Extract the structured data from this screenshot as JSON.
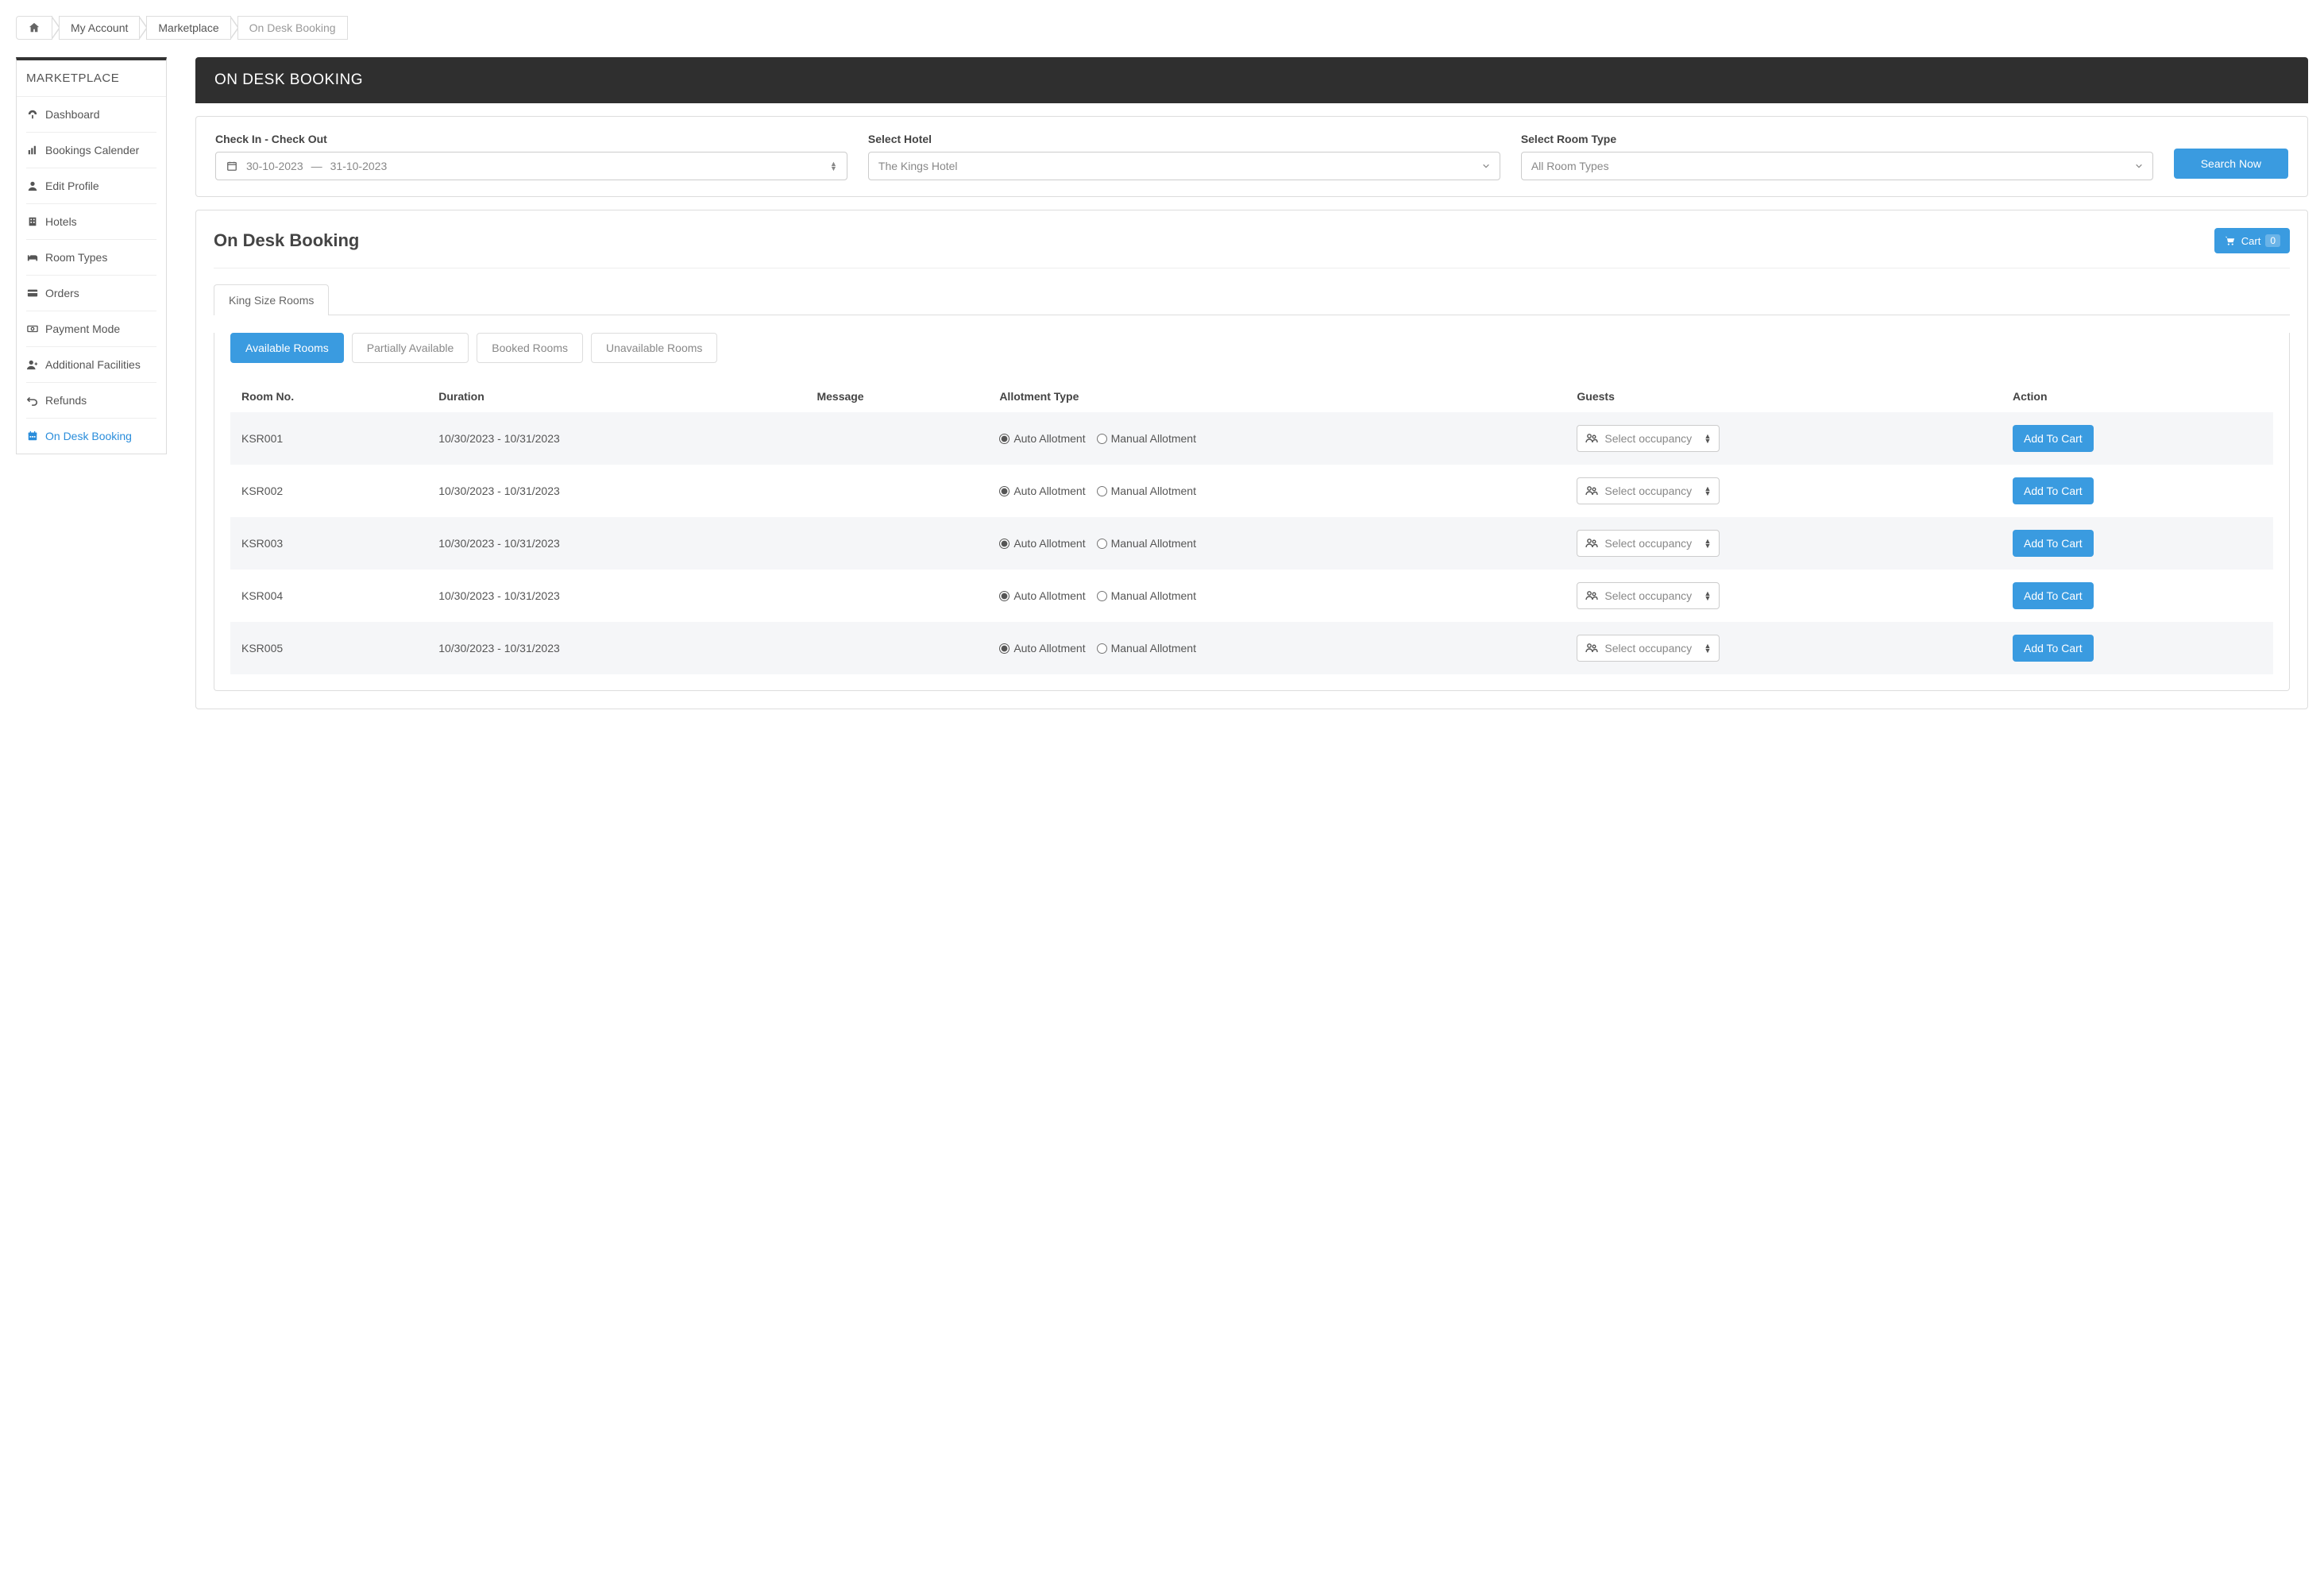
{
  "breadcrumb": {
    "items": [
      {
        "label": "",
        "icon": "home"
      },
      {
        "label": "My Account"
      },
      {
        "label": "Marketplace"
      },
      {
        "label": "On Desk Booking",
        "active": true
      }
    ]
  },
  "sidebar": {
    "title": "MARKETPLACE",
    "items": [
      {
        "label": "Dashboard",
        "icon": "dashboard"
      },
      {
        "label": "Bookings Calender",
        "icon": "bar-chart"
      },
      {
        "label": "Edit Profile",
        "icon": "user"
      },
      {
        "label": "Hotels",
        "icon": "building"
      },
      {
        "label": "Room Types",
        "icon": "bed"
      },
      {
        "label": "Orders",
        "icon": "credit-card"
      },
      {
        "label": "Payment Mode",
        "icon": "cash"
      },
      {
        "label": "Additional Facilities",
        "icon": "user-plus"
      },
      {
        "label": "Refunds",
        "icon": "undo"
      },
      {
        "label": "On Desk Booking",
        "icon": "calendar",
        "selected": true
      }
    ]
  },
  "header": {
    "title": "ON DESK BOOKING"
  },
  "filters": {
    "checkin_label": "Check In - Check Out",
    "date_from": "30-10-2023",
    "date_sep": "—",
    "date_to": "31-10-2023",
    "hotel_label": "Select Hotel",
    "hotel_value": "The Kings Hotel",
    "room_label": "Select Room Type",
    "room_value": "All Room Types",
    "search_btn": "Search Now"
  },
  "section": {
    "title": "On Desk Booking",
    "cart_label": "Cart",
    "cart_count": "0"
  },
  "tabs": [
    {
      "label": "King Size Rooms"
    }
  ],
  "pills": [
    {
      "label": "Available Rooms",
      "active": true
    },
    {
      "label": "Partially Available"
    },
    {
      "label": "Booked Rooms"
    },
    {
      "label": "Unavailable Rooms"
    }
  ],
  "table": {
    "headers": {
      "room": "Room No.",
      "duration": "Duration",
      "message": "Message",
      "allotment": "Allotment Type",
      "guests": "Guests",
      "action": "Action"
    },
    "allot_auto": "Auto Allotment",
    "allot_manual": "Manual Allotment",
    "occupancy_placeholder": "Select occupancy",
    "add_btn": "Add To Cart",
    "rows": [
      {
        "room": "KSR001",
        "duration": "10/30/2023 - 10/31/2023"
      },
      {
        "room": "KSR002",
        "duration": "10/30/2023 - 10/31/2023"
      },
      {
        "room": "KSR003",
        "duration": "10/30/2023 - 10/31/2023"
      },
      {
        "room": "KSR004",
        "duration": "10/30/2023 - 10/31/2023"
      },
      {
        "room": "KSR005",
        "duration": "10/30/2023 - 10/31/2023"
      }
    ]
  }
}
